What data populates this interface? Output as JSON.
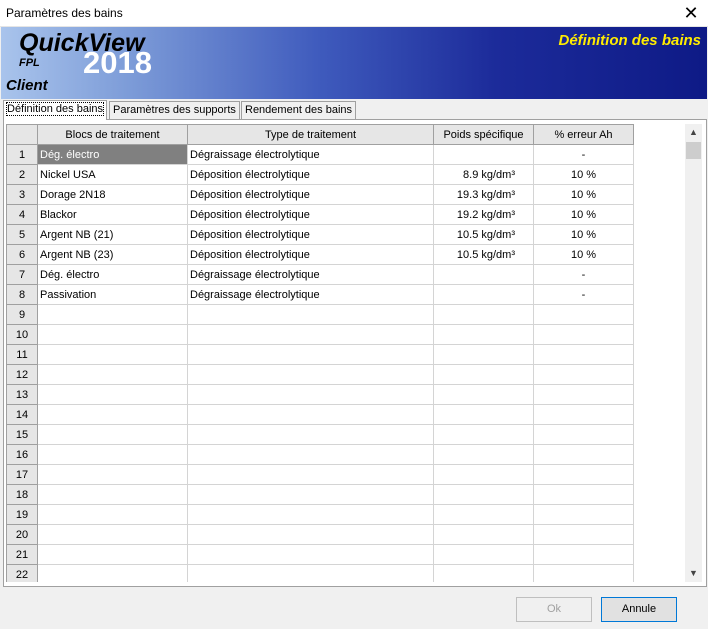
{
  "window": {
    "title": "Paramètres des bains",
    "close_glyph": "✕"
  },
  "banner": {
    "brand": "QuickView",
    "year": "2018",
    "sub": "FPL",
    "client": "Client",
    "sheet_title": "Définition des bains"
  },
  "tabs": [
    {
      "label": "Définition des bains",
      "active": true
    },
    {
      "label": "Paramètres des supports",
      "active": false
    },
    {
      "label": "Rendement des bains",
      "active": false
    }
  ],
  "table": {
    "columns": [
      "Blocs de traitement",
      "Type de traitement",
      "Poids spécifique",
      "% erreur Ah"
    ],
    "rows": [
      {
        "n": "1",
        "bloc": "Dég. électro",
        "type": "Dégraissage électrolytique",
        "poids": "",
        "err": "-"
      },
      {
        "n": "2",
        "bloc": "Nickel USA",
        "type": "Déposition électrolytique",
        "poids": "8.9 kg/dm³",
        "err": "10 %"
      },
      {
        "n": "3",
        "bloc": "Dorage 2N18",
        "type": "Déposition électrolytique",
        "poids": "19.3 kg/dm³",
        "err": "10 %"
      },
      {
        "n": "4",
        "bloc": "Blackor",
        "type": "Déposition électrolytique",
        "poids": "19.2 kg/dm³",
        "err": "10 %"
      },
      {
        "n": "5",
        "bloc": "Argent NB (21)",
        "type": "Déposition électrolytique",
        "poids": "10.5 kg/dm³",
        "err": "10 %"
      },
      {
        "n": "6",
        "bloc": "Argent NB (23)",
        "type": "Déposition électrolytique",
        "poids": "10.5 kg/dm³",
        "err": "10 %"
      },
      {
        "n": "7",
        "bloc": "Dég. électro",
        "type": "Dégraissage électrolytique",
        "poids": "",
        "err": "-"
      },
      {
        "n": "8",
        "bloc": "Passivation",
        "type": "Dégraissage électrolytique",
        "poids": "",
        "err": "-"
      },
      {
        "n": "9",
        "bloc": "",
        "type": "",
        "poids": "",
        "err": ""
      },
      {
        "n": "10",
        "bloc": "",
        "type": "",
        "poids": "",
        "err": ""
      },
      {
        "n": "11",
        "bloc": "",
        "type": "",
        "poids": "",
        "err": ""
      },
      {
        "n": "12",
        "bloc": "",
        "type": "",
        "poids": "",
        "err": ""
      },
      {
        "n": "13",
        "bloc": "",
        "type": "",
        "poids": "",
        "err": ""
      },
      {
        "n": "14",
        "bloc": "",
        "type": "",
        "poids": "",
        "err": ""
      },
      {
        "n": "15",
        "bloc": "",
        "type": "",
        "poids": "",
        "err": ""
      },
      {
        "n": "16",
        "bloc": "",
        "type": "",
        "poids": "",
        "err": ""
      },
      {
        "n": "17",
        "bloc": "",
        "type": "",
        "poids": "",
        "err": ""
      },
      {
        "n": "18",
        "bloc": "",
        "type": "",
        "poids": "",
        "err": ""
      },
      {
        "n": "19",
        "bloc": "",
        "type": "",
        "poids": "",
        "err": ""
      },
      {
        "n": "20",
        "bloc": "",
        "type": "",
        "poids": "",
        "err": ""
      },
      {
        "n": "21",
        "bloc": "",
        "type": "",
        "poids": "",
        "err": ""
      },
      {
        "n": "22",
        "bloc": "",
        "type": "",
        "poids": "",
        "err": ""
      }
    ],
    "selected_row": "1"
  },
  "scrollbar": {
    "up_glyph": "▲",
    "down_glyph": "▼"
  },
  "buttons": {
    "ok": "Ok",
    "cancel": "Annule"
  },
  "colors": {
    "sheet_title": "#ffec00",
    "selected_cell": "#808080"
  }
}
